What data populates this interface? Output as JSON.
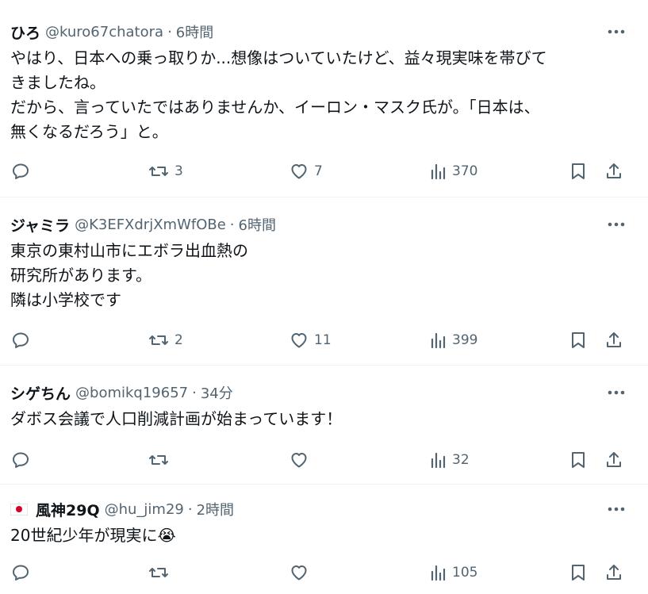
{
  "tweets": [
    {
      "name": "ひろ",
      "handle": "@kuro67chatora",
      "separator": "·",
      "time": "6時間",
      "text": "やはり、日本への乗っ取りか...想像はついていたけど、益々現実味を帯びて\nきましたね。\nだから、言っていたではありませんか、イーロン・マスク氏が。「日本は、\n無くなるだろう」と。",
      "replies": "",
      "retweets": "3",
      "likes": "7",
      "views": "370"
    },
    {
      "name": "ジャミラ",
      "handle": "@K3EFXdrjXmWfOBe",
      "separator": "·",
      "time": "6時間",
      "text": "東京の東村山市にエボラ出血熱の\n研究所があります。\n隣は小学校です",
      "replies": "",
      "retweets": "2",
      "likes": "11",
      "views": "399"
    },
    {
      "name": "シゲちん",
      "handle": "@bomikq19657",
      "separator": "·",
      "time": "34分",
      "text": "ダボス会議で人口削減計画が始まっています！",
      "replies": "",
      "retweets": "",
      "likes": "",
      "views": "32"
    },
    {
      "name": "風神29Q",
      "handle": "@hu_jim29",
      "separator": "·",
      "time": "2時間",
      "text": "20世紀少年が現実に😭",
      "replies": "",
      "retweets": "",
      "likes": "",
      "views": "105",
      "flag_icon": "japan-flag-icon"
    }
  ],
  "icons": {
    "more": "more-horizontal-icon",
    "reply": "reply-icon",
    "retweet": "retweet-icon",
    "like": "heart-icon",
    "views": "views-icon",
    "bookmark": "bookmark-icon",
    "share": "share-icon"
  },
  "colors": {
    "text_primary": "#0f1419",
    "text_secondary": "#536471",
    "divider": "#eff3f4",
    "flag_red": "#d3002a"
  }
}
